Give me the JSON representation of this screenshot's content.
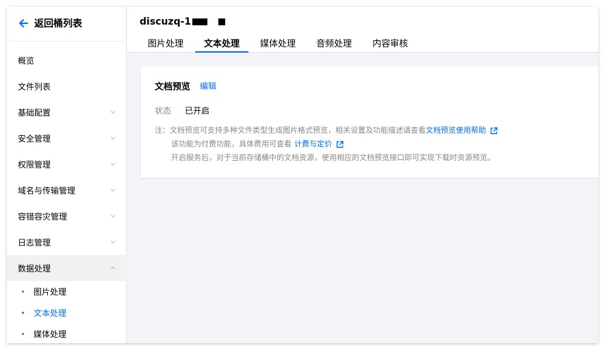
{
  "sidebar": {
    "back_label": "返回桶列表",
    "menu": [
      {
        "label": "概览",
        "has_chevron": false
      },
      {
        "label": "文件列表",
        "has_chevron": false
      },
      {
        "label": "基础配置",
        "has_chevron": true
      },
      {
        "label": "安全管理",
        "has_chevron": true
      },
      {
        "label": "权限管理",
        "has_chevron": true
      },
      {
        "label": "域名与传输管理",
        "has_chevron": true
      },
      {
        "label": "容错容灾管理",
        "has_chevron": true
      },
      {
        "label": "日志管理",
        "has_chevron": true
      },
      {
        "label": "数据处理",
        "has_chevron": true,
        "expanded": true
      }
    ],
    "submenu": [
      {
        "label": "图片处理",
        "active": false
      },
      {
        "label": "文本处理",
        "active": true
      },
      {
        "label": "媒体处理",
        "active": false
      }
    ]
  },
  "header": {
    "bucket_name": "discuzq-1",
    "tabs": [
      {
        "label": "图片处理",
        "active": false
      },
      {
        "label": "文本处理",
        "active": true
      },
      {
        "label": "媒体处理",
        "active": false
      },
      {
        "label": "音频处理",
        "active": false
      },
      {
        "label": "内容审核",
        "active": false
      }
    ]
  },
  "card": {
    "title": "文档预览",
    "edit_label": "编辑",
    "status_key": "状态",
    "status_value": "已开启",
    "note_line1_prefix": "注：文档预览可支持多种文件类型生成图片格式预览，相关设置及功能描述请查看",
    "note_line1_link": "文档预览使用帮助",
    "note_line2_prefix": "该功能为付费功能，具体费用可查看",
    "note_line2_link": "计费与定价",
    "note_line3": "开启服务后，对于当前存储桶中的文档资源，使用相应的文档预览接口即可实现下载时资源预览。"
  },
  "colors": {
    "accent": "#006eff",
    "page_bg": "#f3f4f7",
    "muted_text": "#888888"
  },
  "icons": {
    "back": "arrow-left-icon",
    "chevron": "chevron-down-icon",
    "external": "external-link-icon"
  }
}
